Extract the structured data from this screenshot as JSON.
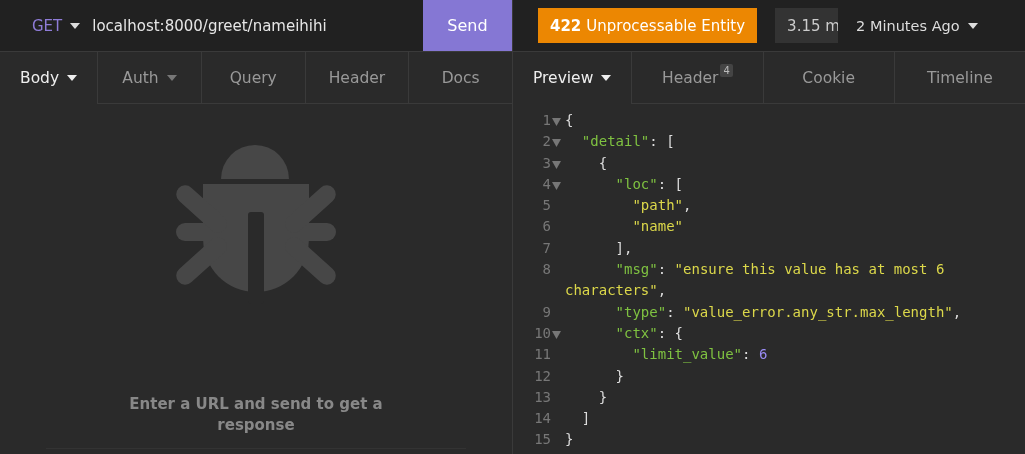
{
  "request": {
    "method": "GET",
    "url": "localhost:8000/greet/nameihihi",
    "send_label": "Send"
  },
  "request_tabs": [
    {
      "label": "Body",
      "selected": true,
      "dropdown": true
    },
    {
      "label": "Auth",
      "selected": false,
      "dropdown": true
    },
    {
      "label": "Query",
      "selected": false,
      "dropdown": false
    },
    {
      "label": "Header",
      "selected": false,
      "dropdown": false
    },
    {
      "label": "Docs",
      "selected": false,
      "dropdown": false
    }
  ],
  "empty_state": {
    "message": "Enter a URL and send to get a response"
  },
  "response": {
    "status_code": "422",
    "status_text": "Unprocessable Entity",
    "color": "#ec8702",
    "time": "3.15 m",
    "age": "2 Minutes Ago"
  },
  "response_tabs": [
    {
      "label": "Preview",
      "selected": true,
      "dropdown": true
    },
    {
      "label": "Header",
      "selected": false,
      "dropdown": false,
      "badge": "4"
    },
    {
      "label": "Cookie",
      "selected": false,
      "dropdown": false
    },
    {
      "label": "Timeline",
      "selected": false,
      "dropdown": false
    }
  ],
  "code_lines": [
    {
      "number": "1",
      "foldable": true,
      "tokens": [
        {
          "kind": "punct",
          "text": "{"
        }
      ]
    },
    {
      "number": "2",
      "foldable": true,
      "tokens": [
        {
          "kind": "key",
          "text": "  \"detail\""
        },
        {
          "kind": "punct",
          "text": ": ["
        }
      ]
    },
    {
      "number": "3",
      "foldable": true,
      "tokens": [
        {
          "kind": "punct",
          "text": "    {"
        }
      ]
    },
    {
      "number": "4",
      "foldable": true,
      "tokens": [
        {
          "kind": "key",
          "text": "      \"loc\""
        },
        {
          "kind": "punct",
          "text": ": ["
        }
      ]
    },
    {
      "number": "5",
      "foldable": false,
      "tokens": [
        {
          "kind": "string",
          "text": "        \"path\""
        },
        {
          "kind": "punct",
          "text": ","
        }
      ]
    },
    {
      "number": "6",
      "foldable": false,
      "tokens": [
        {
          "kind": "string",
          "text": "        \"name\""
        }
      ]
    },
    {
      "number": "7",
      "foldable": false,
      "tokens": [
        {
          "kind": "punct",
          "text": "      ],"
        }
      ]
    },
    {
      "number": "8",
      "foldable": false,
      "tokens": [
        {
          "kind": "key",
          "text": "      \"msg\""
        },
        {
          "kind": "punct",
          "text": ": "
        },
        {
          "kind": "string",
          "text": "\"ensure this value has at most 6 characters\""
        },
        {
          "kind": "punct",
          "text": ","
        }
      ]
    },
    {
      "number": "9",
      "foldable": false,
      "tokens": [
        {
          "kind": "key",
          "text": "      \"type\""
        },
        {
          "kind": "punct",
          "text": ": "
        },
        {
          "kind": "string",
          "text": "\"value_error.any_str.max_length\""
        },
        {
          "kind": "punct",
          "text": ","
        }
      ]
    },
    {
      "number": "10",
      "foldable": true,
      "tokens": [
        {
          "kind": "key",
          "text": "      \"ctx\""
        },
        {
          "kind": "punct",
          "text": ": {"
        }
      ]
    },
    {
      "number": "11",
      "foldable": false,
      "tokens": [
        {
          "kind": "key",
          "text": "        \"limit_value\""
        },
        {
          "kind": "punct",
          "text": ": "
        },
        {
          "kind": "number",
          "text": "6"
        }
      ]
    },
    {
      "number": "12",
      "foldable": false,
      "tokens": [
        {
          "kind": "punct",
          "text": "      }"
        }
      ]
    },
    {
      "number": "13",
      "foldable": false,
      "tokens": [
        {
          "kind": "punct",
          "text": "    }"
        }
      ]
    },
    {
      "number": "14",
      "foldable": false,
      "tokens": [
        {
          "kind": "punct",
          "text": "  ]"
        }
      ]
    },
    {
      "number": "15",
      "foldable": false,
      "tokens": [
        {
          "kind": "punct",
          "text": "}"
        }
      ]
    }
  ]
}
